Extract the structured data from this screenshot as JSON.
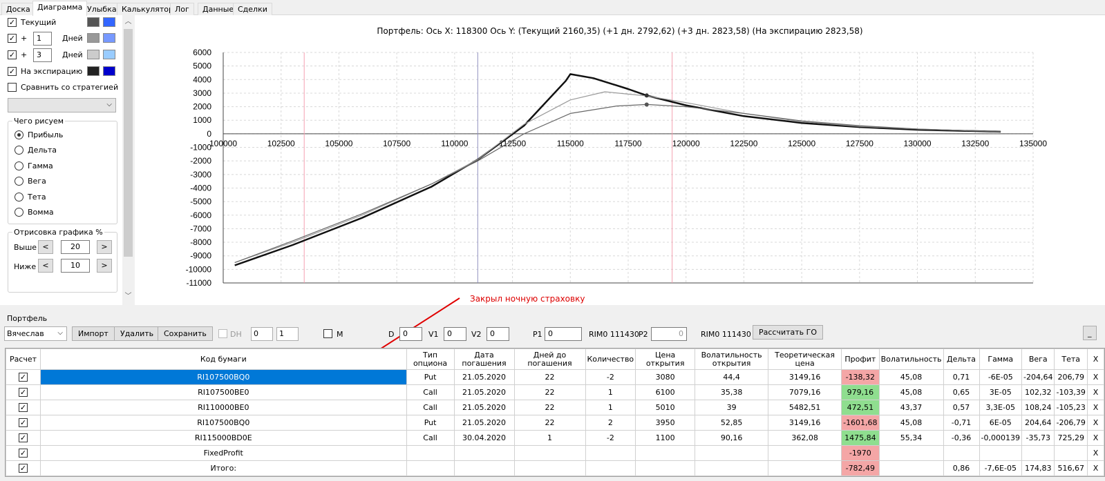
{
  "tabs": [
    "Доска",
    "Диаграмма",
    "Улыбка",
    "Калькулятор",
    "Лог",
    "Данные",
    "Сделки"
  ],
  "active_tab": "Диаграмма",
  "left": {
    "current_label": "Текущий",
    "plus": "+",
    "days1_value": "1",
    "days2_value": "3",
    "days_label": "Дней",
    "expiry_label": "На экспирацию",
    "compare_label": "Сравнить со стратегией",
    "draw_group_title": "Чего рисуем",
    "radio_options": [
      "Прибыль",
      "Дельта",
      "Гамма",
      "Вега",
      "Тета",
      "Вомма"
    ],
    "render_group_title": "Отрисовка графика %",
    "above_label": "Выше",
    "above_value": "20",
    "below_label": "Ниже",
    "below_value": "10",
    "lt": "<",
    "gt": ">",
    "swatch_colors": [
      [
        "#555555",
        "#3366ff"
      ],
      [
        "#999999",
        "#7799ff"
      ],
      [
        "#cccccc",
        "#99ccff"
      ],
      [
        "#222222",
        "#0000cc"
      ]
    ]
  },
  "chart_title": "Портфель: Ось X: 118300 Ось Y: (Текущий 2160,35) (+1 дн. 2792,62) (+3 дн. 2823,58) (На экспирацию 2823,58)",
  "annotation": "Закрыл ночную страховку",
  "chart_data": {
    "type": "line",
    "x_ticks": [
      "100000",
      "102500",
      "105000",
      "107500",
      "110000",
      "112500",
      "115000",
      "117500",
      "120000",
      "122500",
      "125000",
      "127500",
      "130000",
      "132500",
      "135000"
    ],
    "y_ticks": [
      "6000",
      "5000",
      "4000",
      "3000",
      "2000",
      "1000",
      "0",
      "-1000",
      "-2000",
      "-3000",
      "-4000",
      "-5000",
      "-6000",
      "-7000",
      "-8000",
      "-9000",
      "-10000",
      "-11000"
    ],
    "xlim": [
      100000,
      135000
    ],
    "ylim": [
      -11000,
      6000
    ],
    "vlines": [
      103500,
      111000,
      119400
    ],
    "series": [
      {
        "x": [
          100500,
          103000,
          106000,
          109000,
          111000,
          113000,
          114800,
          115000,
          116000,
          117500,
          118300,
          120000,
          122500,
          125000,
          127500,
          130000,
          133600
        ],
        "y": [
          -9700,
          -8200,
          -6200,
          -3900,
          -1900,
          600,
          3900,
          4400,
          4100,
          3300,
          2823,
          2100,
          1300,
          800,
          500,
          300,
          150
        ]
      },
      {
        "x": [
          100500,
          103000,
          106000,
          109000,
          111000,
          113000,
          115000,
          116500,
          118300,
          120000,
          122500,
          125000,
          127500,
          130000,
          133600
        ],
        "y": [
          -9500,
          -8000,
          -6000,
          -3700,
          -1900,
          700,
          2500,
          3100,
          2792,
          2300,
          1500,
          900,
          550,
          350,
          150
        ]
      },
      {
        "x": [
          100500,
          103000,
          106000,
          109000,
          111000,
          113000,
          115000,
          117000,
          118300,
          120000,
          122500,
          125000,
          127500,
          130000,
          133600
        ],
        "y": [
          -9500,
          -7900,
          -5900,
          -3700,
          -2000,
          0,
          1500,
          2050,
          2160,
          2000,
          1500,
          950,
          600,
          350,
          150
        ]
      }
    ]
  },
  "portfolio": {
    "label": "Портфель",
    "user": "Вячеслав",
    "import": "Импорт",
    "delete": "Удалить",
    "save": "Сохранить",
    "dh": "DH",
    "spin1": "0",
    "spin2": "1",
    "m": "M",
    "d_label": "D",
    "d_value": "0",
    "v1_label": "V1",
    "v1_value": "0",
    "v2_label": "V2",
    "v2_value": "0",
    "p1_label": "P1",
    "p1_value": "0",
    "rim1": "RIM0 111430",
    "p2_label": "P2",
    "p2_value": "0",
    "rim2": "RIM0 111430",
    "calc_go": "Рассчитать ГО",
    "underscore": "_"
  },
  "table": {
    "headers": [
      "Расчет",
      "Код бумаги",
      "Тип опциона",
      "Дата погашения",
      "Дней до погашения",
      "Количество",
      "Цена открытия",
      "Волатильность открытия",
      "Теоретическая цена",
      "Профит",
      "Волатильность",
      "Дельта",
      "Гамма",
      "Вега",
      "Тета",
      "X"
    ],
    "rows": [
      {
        "code": "RI107500BQ0",
        "type": "Put",
        "date": "21.05.2020",
        "days": "22",
        "qty": "-2",
        "price": "3080",
        "vol_open": "44,4",
        "theo": "3149,16",
        "profit": "-138,32",
        "vol": "45,08",
        "delta": "0,71",
        "gamma": "-6E-05",
        "vega": "-204,64",
        "theta": "206,79",
        "x": "X"
      },
      {
        "code": "RI107500BE0",
        "type": "Call",
        "date": "21.05.2020",
        "days": "22",
        "qty": "1",
        "price": "6100",
        "vol_open": "35,38",
        "theo": "7079,16",
        "profit": "979,16",
        "vol": "45,08",
        "delta": "0,65",
        "gamma": "3E-05",
        "vega": "102,32",
        "theta": "-103,39",
        "x": "X"
      },
      {
        "code": "RI110000BE0",
        "type": "Call",
        "date": "21.05.2020",
        "days": "22",
        "qty": "1",
        "price": "5010",
        "vol_open": "39",
        "theo": "5482,51",
        "profit": "472,51",
        "vol": "43,37",
        "delta": "0,57",
        "gamma": "3,3E-05",
        "vega": "108,24",
        "theta": "-105,23",
        "x": "X"
      },
      {
        "code": "RI107500BQ0",
        "type": "Put",
        "date": "21.05.2020",
        "days": "22",
        "qty": "2",
        "price": "3950",
        "vol_open": "52,85",
        "theo": "3149,16",
        "profit": "-1601,68",
        "vol": "45,08",
        "delta": "-0,71",
        "gamma": "6E-05",
        "vega": "204,64",
        "theta": "-206,79",
        "x": "X"
      },
      {
        "code": "RI115000BD0E",
        "type": "Call",
        "date": "30.04.2020",
        "days": "1",
        "qty": "-2",
        "price": "1100",
        "vol_open": "90,16",
        "theo": "362,08",
        "profit": "1475,84",
        "vol": "55,34",
        "delta": "-0,36",
        "gamma": "-0,000139",
        "vega": "-35,73",
        "theta": "725,29",
        "x": "X"
      },
      {
        "code": "FixedProfit",
        "type": "",
        "date": "",
        "days": "",
        "qty": "",
        "price": "",
        "vol_open": "",
        "theo": "",
        "profit": "-1970",
        "vol": "",
        "delta": "",
        "gamma": "",
        "vega": "",
        "theta": "",
        "x": "X"
      },
      {
        "code": "Итого:",
        "type": "",
        "date": "",
        "days": "",
        "qty": "",
        "price": "",
        "vol_open": "",
        "theo": "",
        "profit": "-782,49",
        "vol": "",
        "delta": "0,86",
        "gamma": "-7,6E-05",
        "vega": "174,83",
        "theta": "516,67",
        "x": "X"
      }
    ]
  }
}
